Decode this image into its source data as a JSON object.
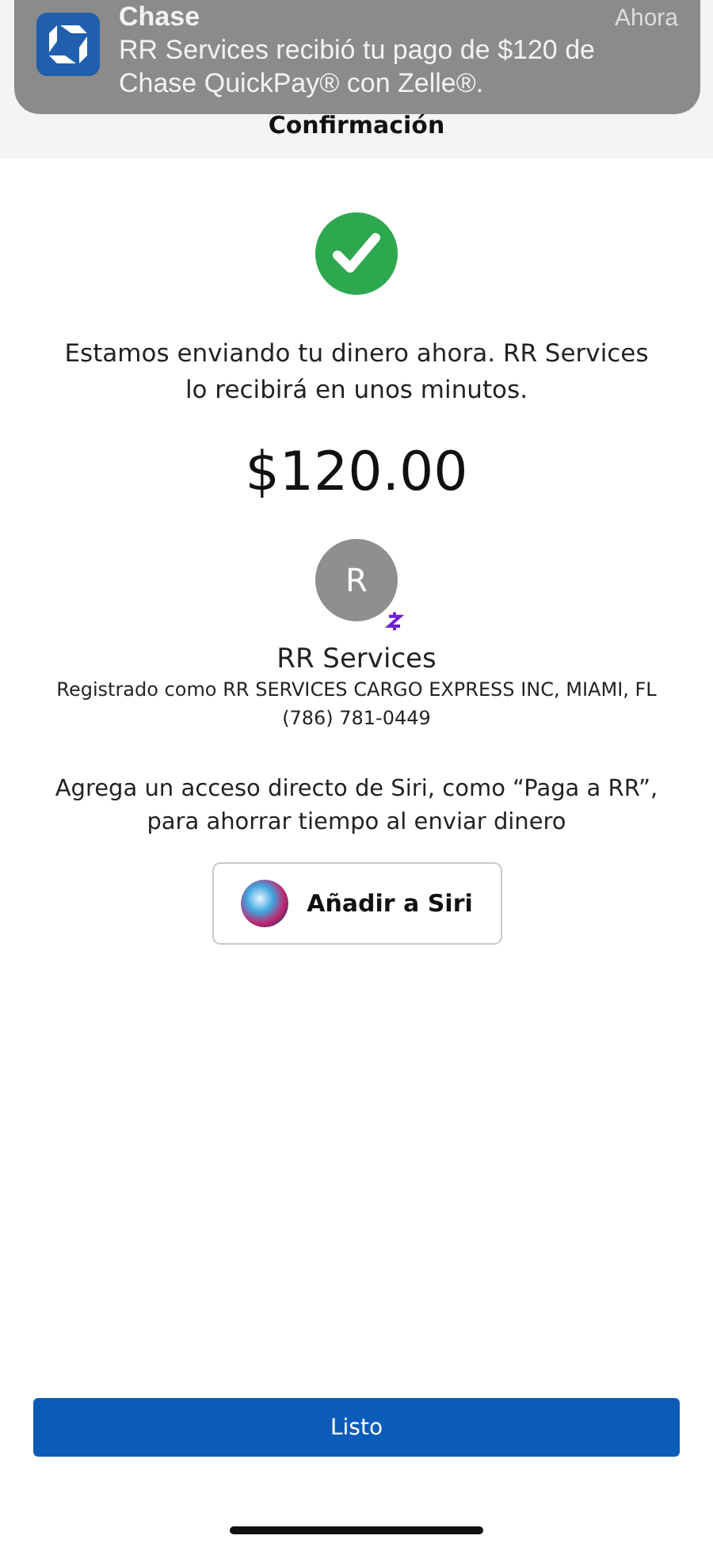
{
  "notification": {
    "app": "Chase",
    "time": "Ahora",
    "message": "RR Services recibió tu pago de $120 de Chase QuickPay® con Zelle®."
  },
  "header": {
    "title": "Confirmación"
  },
  "confirmation": {
    "message": "Estamos enviando tu dinero ahora. RR Services lo recibirá en unos minutos.",
    "amount": "$120.00"
  },
  "recipient": {
    "initial": "R",
    "name": "RR Services",
    "registered": "Registrado como RR SERVICES CARGO EXPRESS INC, MIAMI, FL",
    "phone": "(786) 781-0449"
  },
  "siri": {
    "prompt": "Agrega un acceso directo de Siri, como “Paga a RR”, para ahorrar tiempo al enviar dinero",
    "button": "Añadir a Siri"
  },
  "done_button": "Listo"
}
